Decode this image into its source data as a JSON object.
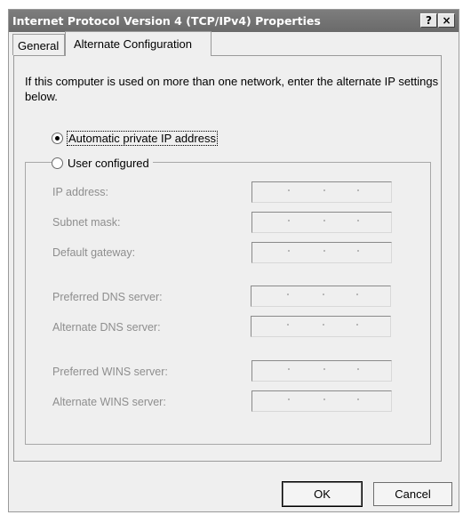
{
  "window": {
    "title": "Internet Protocol Version 4 (TCP/IPv4) Properties",
    "help_label": "?",
    "close_label": "×"
  },
  "tabs": [
    {
      "label": "General",
      "active": false
    },
    {
      "label": "Alternate Configuration",
      "active": true
    }
  ],
  "intro_text": "If this computer is used on more than one network, enter the alternate IP settings below.",
  "options": {
    "automatic": {
      "label": "Automatic private IP address",
      "selected": true
    },
    "user": {
      "label": "User configured",
      "selected": false
    }
  },
  "fields": {
    "ip_address": {
      "label": "IP address:",
      "value": ""
    },
    "subnet_mask": {
      "label": "Subnet mask:",
      "value": ""
    },
    "default_gateway": {
      "label": "Default gateway:",
      "value": ""
    },
    "preferred_dns": {
      "label": "Preferred DNS server:",
      "value": ""
    },
    "alternate_dns": {
      "label": "Alternate DNS server:",
      "value": ""
    },
    "preferred_wins": {
      "label": "Preferred WINS server:",
      "value": ""
    },
    "alternate_wins": {
      "label": "Alternate WINS server:",
      "value": ""
    }
  },
  "buttons": {
    "ok": "OK",
    "cancel": "Cancel"
  }
}
